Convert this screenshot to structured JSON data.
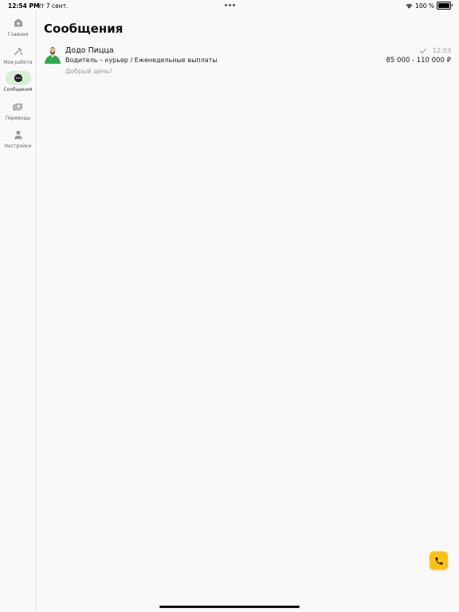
{
  "status_bar": {
    "time": "12:54 PM",
    "date": "Чт 7 сент.",
    "battery_text": "100 %",
    "battery_level": 1.0
  },
  "sidebar": {
    "items": [
      {
        "label": "Главная",
        "icon": "home-icon",
        "active": false
      },
      {
        "label": "Моя работа",
        "icon": "tools-icon",
        "active": false
      },
      {
        "label": "Сообщения",
        "icon": "chat-icon",
        "active": true
      },
      {
        "label": "Переводы",
        "icon": "money-icon",
        "active": false
      },
      {
        "label": "Настройки",
        "icon": "person-icon",
        "active": false
      }
    ]
  },
  "main": {
    "title": "Сообщения",
    "chats": [
      {
        "company": "Додо Пицца",
        "vacancy": "Водитель – курьер / Еженедельные выплаты",
        "last_message": "Добрый день!",
        "time": "12:53",
        "salary": "85 000 - 110 000 ₽",
        "status_icon": "checkmark-icon"
      }
    ]
  },
  "colors": {
    "active_nav_bg": "#d7efd9",
    "fab": "#ffc30f",
    "avatar_green": "#2eaa4c",
    "background": "#f9f9f9"
  }
}
